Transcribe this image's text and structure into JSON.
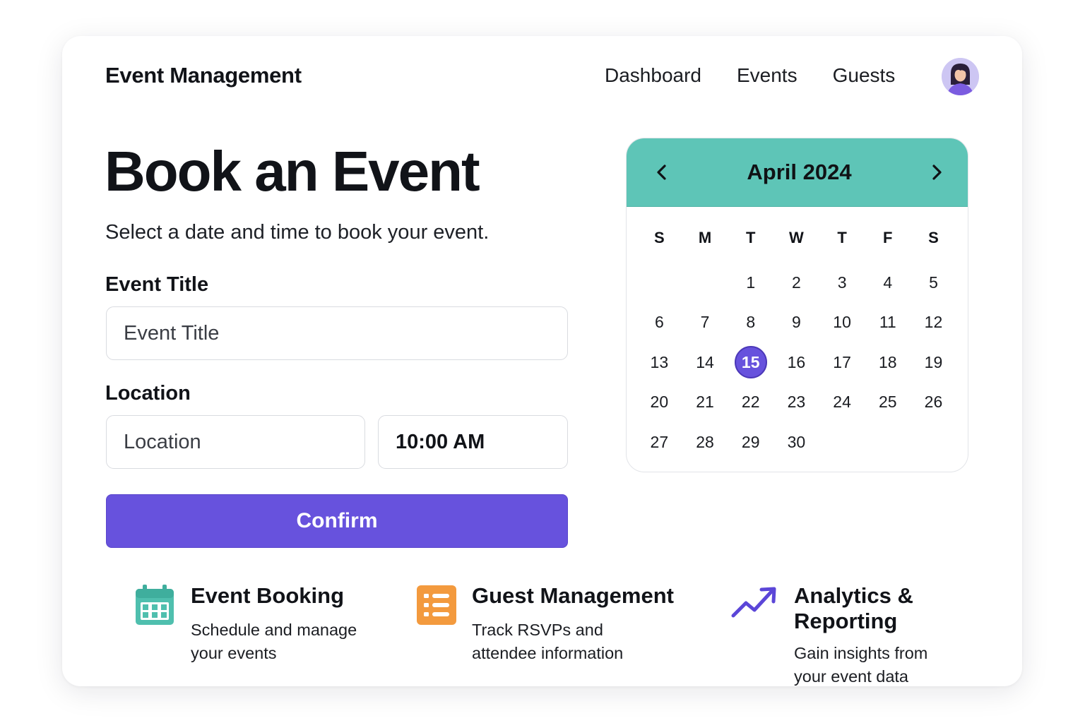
{
  "header": {
    "brand": "Event Management",
    "nav": [
      "Dashboard",
      "Events",
      "Guests"
    ]
  },
  "hero": {
    "title": "Book an Event",
    "subtitle": "Select a date and time to book your event."
  },
  "form": {
    "event_title_label": "Event Title",
    "event_title_placeholder": "Event Title",
    "location_label": "Location",
    "location_placeholder": "Location",
    "time_value": "10:00 AM",
    "confirm_label": "Confirm"
  },
  "calendar": {
    "month_label": "April 2024",
    "prev_icon": "chevron-left-icon",
    "next_icon": "chevron-right-icon",
    "weekdays": [
      "S",
      "M",
      "T",
      "W",
      "T",
      "F",
      "S"
    ],
    "leading_blanks": 2,
    "days": [
      "1",
      "2",
      "3",
      "4",
      "5",
      "6",
      "7",
      "8",
      "9",
      "10",
      "11",
      "12",
      "13",
      "14",
      "15",
      "16",
      "17",
      "18",
      "19",
      "20",
      "21",
      "22",
      "23",
      "24",
      "25",
      "26",
      "27",
      "28",
      "29",
      "30"
    ],
    "selected_day": "15",
    "accent_color": "#5ec5b7",
    "selected_color": "#6752dd"
  },
  "features": [
    {
      "icon": "calendar-icon",
      "color": "#4fbfae",
      "title": "Event Booking",
      "desc": "Schedule and manage your events"
    },
    {
      "icon": "list-icon",
      "color": "#f39a3e",
      "title": "Guest Management",
      "desc": "Track RSVPs and attendee information"
    },
    {
      "icon": "trend-up-icon",
      "color": "#5b46d8",
      "title": "Analytics & Reporting",
      "desc": "Gain insights from your event data"
    }
  ],
  "colors": {
    "primary": "#6752dd",
    "teal": "#5ec5b7"
  }
}
